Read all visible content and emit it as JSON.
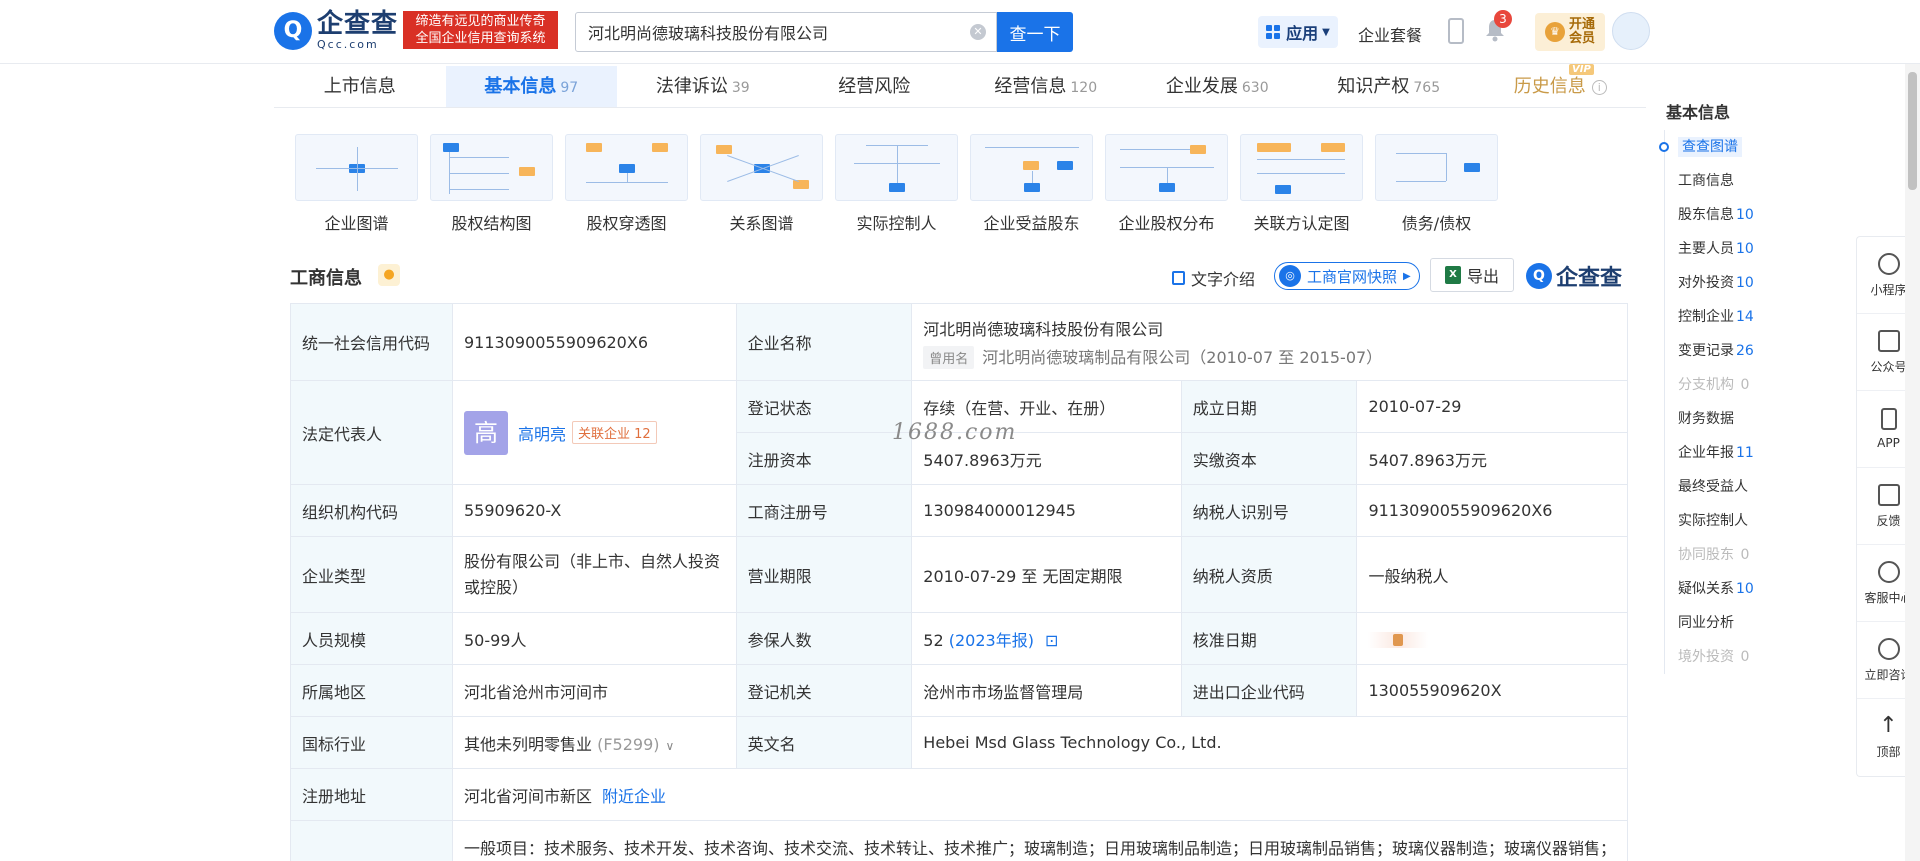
{
  "header": {
    "logo_text": "企查查",
    "logo_domain": "Qcc.com",
    "slogan_line1": "缔造有远见的商业传奇",
    "slogan_line2": "全国企业信用查询系统",
    "search_value": "河北明尚德玻璃科技股份有限公司",
    "search_button": "查一下",
    "apps_label": "应用",
    "package_label": "企业套餐",
    "notification_count": "3",
    "vip_line1": "开通",
    "vip_line2": "会员"
  },
  "tabs": [
    {
      "label": "上市信息",
      "count": ""
    },
    {
      "label": "基本信息",
      "count": "97"
    },
    {
      "label": "法律诉讼",
      "count": "39"
    },
    {
      "label": "经营风险",
      "count": ""
    },
    {
      "label": "经营信息",
      "count": "120"
    },
    {
      "label": "企业发展",
      "count": "630"
    },
    {
      "label": "知识产权",
      "count": "765"
    },
    {
      "label": "历史信息",
      "count": ""
    }
  ],
  "vip_tag": "VIP",
  "graphs": [
    "企业图谱",
    "股权结构图",
    "股权穿透图",
    "关系图谱",
    "实际控制人",
    "企业受益股东",
    "企业股权分布",
    "关联方认定图",
    "债务/债权"
  ],
  "section": {
    "title": "工商信息",
    "text_intro": "文字介绍",
    "snapshot": "工商官网快照",
    "export": "导出",
    "brand": "企查查"
  },
  "info": {
    "credit_code_k": "统一社会信用代码",
    "credit_code_v": "9113090055909620X6",
    "company_name_k": "企业名称",
    "company_name_v": "河北明尚德玻璃科技股份有限公司",
    "used_name_tag": "曾用名",
    "used_name_v": "河北明尚德玻璃制品有限公司（2010-07 至 2015-07）",
    "legal_rep_k": "法定代表人",
    "legal_rep_avatar": "高",
    "legal_rep_name": "高明亮",
    "related_label": "关联企业",
    "related_count": "12",
    "reg_status_k": "登记状态",
    "reg_status_v": "存续（在营、开业、在册）",
    "found_date_k": "成立日期",
    "found_date_v": "2010-07-29",
    "reg_capital_k": "注册资本",
    "reg_capital_v": "5407.8963万元",
    "paid_capital_k": "实缴资本",
    "paid_capital_v": "5407.8963万元",
    "org_code_k": "组织机构代码",
    "org_code_v": "55909620-X",
    "biz_reg_no_k": "工商注册号",
    "biz_reg_no_v": "130984000012945",
    "taxpayer_id_k": "纳税人识别号",
    "taxpayer_id_v": "9113090055909620X6",
    "company_type_k": "企业类型",
    "company_type_v": "股份有限公司（非上市、自然人投资或控股）",
    "biz_term_k": "营业期限",
    "biz_term_v": "2010-07-29 至 无固定期限",
    "taxpayer_q_k": "纳税人资质",
    "taxpayer_q_v": "一般纳税人",
    "staff_size_k": "人员规模",
    "staff_size_v": "50-99人",
    "insured_k": "参保人数",
    "insured_v": "52",
    "insured_year": "(2023年报)",
    "approve_date_k": "核准日期",
    "region_k": "所属地区",
    "region_v": "河北省沧州市河间市",
    "reg_authority_k": "登记机关",
    "reg_authority_v": "沧州市市场监督管理局",
    "import_export_k": "进出口企业代码",
    "import_export_v": "130055909620X",
    "industry_k": "国标行业",
    "industry_v": "其他未列明零售业",
    "industry_code": "(F5299)",
    "english_name_k": "英文名",
    "english_name_v": "Hebei Msd Glass Technology Co., Ltd.",
    "address_k": "注册地址",
    "address_v": "河北省河间市新区",
    "nearby": "附近企业",
    "scope_v": "一般项目：技术服务、技术开发、技术咨询、技术交流、技术转让、技术推广；玻璃制造；日用玻璃制品制造；日用玻璃制品销售；玻璃仪器制造；玻璃仪器销售；"
  },
  "watermark": "1688.com",
  "side_nav": {
    "title": "基本信息",
    "items": [
      {
        "label": "查查图谱",
        "count": ""
      },
      {
        "label": "工商信息",
        "count": ""
      },
      {
        "label": "股东信息",
        "count": "10"
      },
      {
        "label": "主要人员",
        "count": "10"
      },
      {
        "label": "对外投资",
        "count": "10"
      },
      {
        "label": "控制企业",
        "count": "14"
      },
      {
        "label": "变更记录",
        "count": "26"
      },
      {
        "label": "分支机构",
        "count": "0"
      },
      {
        "label": "财务数据",
        "count": ""
      },
      {
        "label": "企业年报",
        "count": "11"
      },
      {
        "label": "最终受益人",
        "count": ""
      },
      {
        "label": "实际控制人",
        "count": ""
      },
      {
        "label": "协同股东",
        "count": "0"
      },
      {
        "label": "疑似关系",
        "count": "10"
      },
      {
        "label": "同业分析",
        "count": ""
      },
      {
        "label": "境外投资",
        "count": "0"
      }
    ]
  },
  "float_bar": [
    "小程序",
    "公众号",
    "APP",
    "反馈",
    "客服中心",
    "立即咨询",
    "顶部"
  ]
}
